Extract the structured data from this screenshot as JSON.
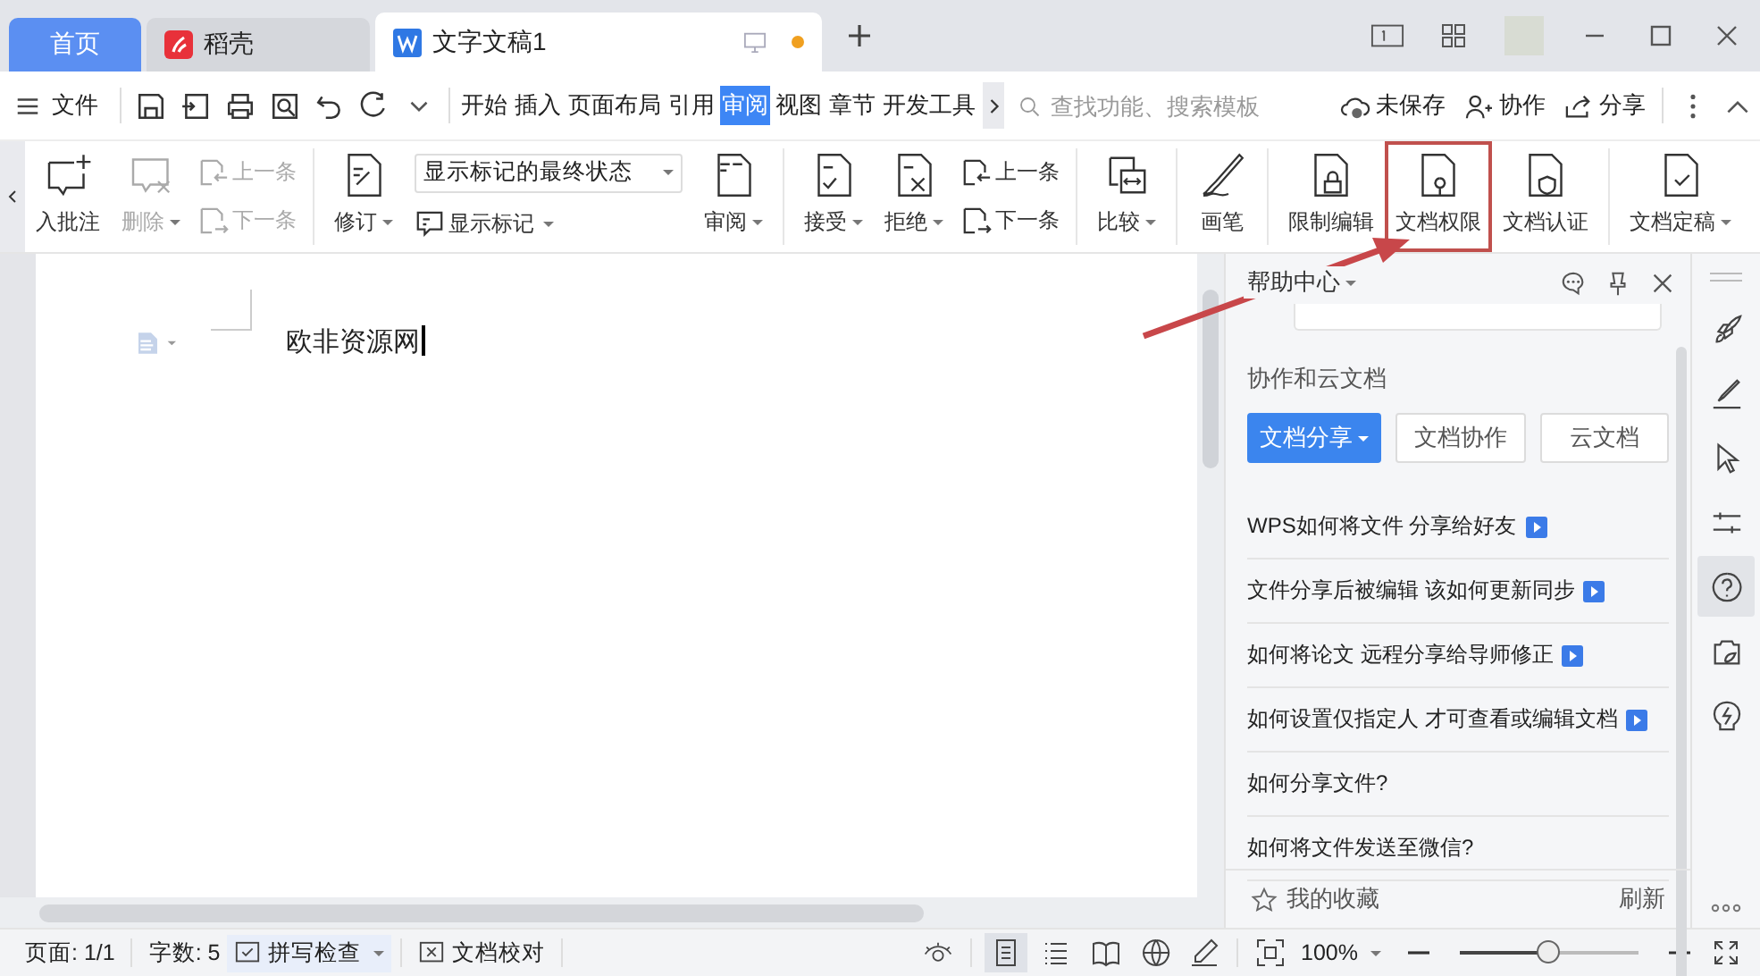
{
  "tabs": [
    {
      "label": "首页",
      "kind": "home",
      "selected": false
    },
    {
      "label": "稻壳",
      "kind": "docer",
      "selected": false
    },
    {
      "label": "文字文稿1",
      "kind": "doc",
      "selected": true,
      "unsaved": true
    }
  ],
  "menu": {
    "file": "文件",
    "tabs": [
      {
        "label": "开始",
        "selected": false
      },
      {
        "label": "插入",
        "selected": false
      },
      {
        "label": "页面布局",
        "selected": false
      },
      {
        "label": "引用",
        "selected": false
      },
      {
        "label": "审阅",
        "selected": true
      },
      {
        "label": "视图",
        "selected": false
      },
      {
        "label": "章节",
        "selected": false
      },
      {
        "label": "开发工具",
        "selected": false
      }
    ],
    "search": {
      "placeholder": "查找功能、搜索模板"
    },
    "actions": [
      "未保存",
      "协作",
      "分享"
    ]
  },
  "ribbon": [
    [
      {
        "kind": "big",
        "label": "入批注",
        "dropdown": false,
        "disabled": false,
        "highlighted": false
      },
      {
        "kind": "big",
        "label": "删除",
        "dropdown": true,
        "disabled": true,
        "highlighted": false
      },
      {
        "kind": "pair",
        "items": [
          {
            "label": "上一条",
            "disabled": true
          },
          {
            "label": "下一条",
            "disabled": true
          }
        ]
      }
    ],
    [
      {
        "kind": "big",
        "label": "修订",
        "dropdown": true,
        "disabled": false,
        "highlighted": false
      },
      {
        "kind": "select",
        "value": "显示标记的最终状态",
        "sub": "显示标记"
      },
      {
        "kind": "big",
        "label": "审阅",
        "dropdown": true,
        "disabled": false,
        "highlighted": false
      }
    ],
    [
      {
        "kind": "big",
        "label": "接受",
        "dropdown": true,
        "disabled": false,
        "highlighted": false
      },
      {
        "kind": "big",
        "label": "拒绝",
        "dropdown": true,
        "disabled": false,
        "highlighted": false
      },
      {
        "kind": "pair",
        "items": [
          {
            "label": "上一条",
            "disabled": false
          },
          {
            "label": "下一条",
            "disabled": false
          }
        ]
      }
    ],
    [
      {
        "kind": "big",
        "label": "比较",
        "dropdown": true,
        "disabled": false,
        "highlighted": false
      }
    ],
    [
      {
        "kind": "big",
        "label": "画笔",
        "dropdown": false,
        "disabled": false,
        "highlighted": false
      }
    ],
    [
      {
        "kind": "big",
        "label": "限制编辑",
        "dropdown": false,
        "disabled": false,
        "highlighted": false
      },
      {
        "kind": "big",
        "label": "文档权限",
        "dropdown": false,
        "disabled": false,
        "highlighted": true
      },
      {
        "kind": "big",
        "label": "文档认证",
        "dropdown": false,
        "disabled": false,
        "highlighted": false
      }
    ],
    [
      {
        "kind": "big",
        "label": "文档定稿",
        "dropdown": true,
        "disabled": false,
        "highlighted": false
      }
    ]
  ],
  "document": {
    "text": "欧非资源网"
  },
  "help_panel": {
    "title": "帮助中心",
    "section": "协作和云文档",
    "buttons": [
      {
        "label": "文档分享",
        "selected": true
      },
      {
        "label": "文档协作",
        "selected": false
      },
      {
        "label": "云文档",
        "selected": false
      }
    ],
    "articles": [
      {
        "text": "WPS如何将文件 分享给好友",
        "video": true
      },
      {
        "text": "文件分享后被编辑 该如何更新同步",
        "video": true
      },
      {
        "text": "如何将论文 远程分享给导师修正",
        "video": true
      },
      {
        "text": "如何设置仅指定人 才可查看或编辑文档",
        "video": true
      },
      {
        "text": "如何分享文件?",
        "video": false
      },
      {
        "text": "如何将文件发送至微信?",
        "video": false
      }
    ],
    "favorites": "我的收藏",
    "refresh": "刷新"
  },
  "side_tools": [
    {
      "selected": false
    },
    {
      "selected": false
    },
    {
      "selected": false
    },
    {
      "selected": false
    },
    {
      "selected": true
    },
    {
      "selected": false
    },
    {
      "selected": false
    }
  ],
  "status_bar": {
    "page": "页面: 1/1",
    "words": "字数: 5",
    "spell": "拼写检查",
    "proof": "文档校对",
    "views": [
      {
        "selected": true
      },
      {
        "selected": false
      },
      {
        "selected": false
      },
      {
        "selected": false
      }
    ],
    "zoom": "100%",
    "zoom_slider": {
      "level": 0.5
    }
  }
}
